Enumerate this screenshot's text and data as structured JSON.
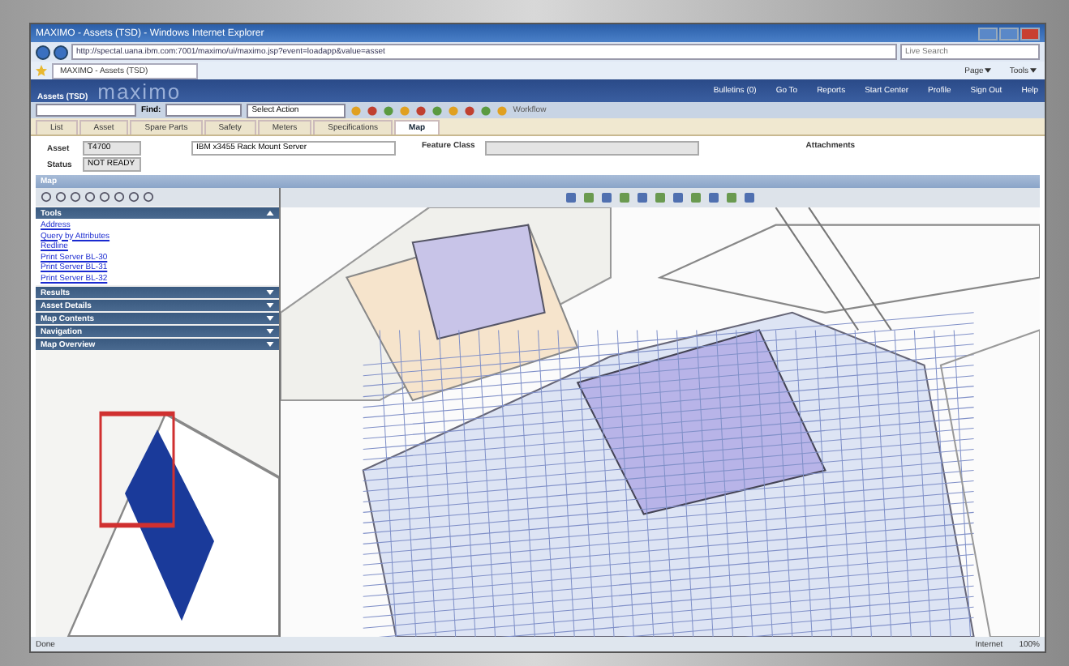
{
  "window": {
    "title": "MAXIMO - Assets (TSD) - Windows Internet Explorer"
  },
  "browser": {
    "address": "http://spectal.uana.ibm.com:7001/maximo/ui/maximo.jsp?event=loadapp&value=asset",
    "search_placeholder": "Live Search",
    "tab_title": "MAXIMO - Assets (TSD)",
    "commands": [
      {
        "label": "Page"
      },
      {
        "label": "Tools"
      }
    ]
  },
  "app": {
    "app_name": "Assets (TSD)",
    "logo": "maximo",
    "nav_links": [
      {
        "label": "Bulletins (0)"
      },
      {
        "label": "Go To"
      },
      {
        "label": "Reports"
      },
      {
        "label": "Start Center"
      },
      {
        "label": "Profile"
      },
      {
        "label": "Sign Out"
      },
      {
        "label": "Help"
      }
    ]
  },
  "toolbar": {
    "find_label": "Find:",
    "select_action": "Select Action",
    "filter_label": "Workflow"
  },
  "tabs": [
    {
      "label": "List",
      "selected": false
    },
    {
      "label": "Asset",
      "selected": false
    },
    {
      "label": "Spare Parts",
      "selected": false
    },
    {
      "label": "Safety",
      "selected": false
    },
    {
      "label": "Meters",
      "selected": false
    },
    {
      "label": "Specifications",
      "selected": false
    },
    {
      "label": "Map",
      "selected": true
    }
  ],
  "record": {
    "asset_label": "Asset",
    "asset_value": "T4700",
    "description": "IBM x3455 Rack Mount Server",
    "status_label": "Status",
    "status_value": "NOT READY",
    "feature_class_label": "Feature Class",
    "attachments_label": "Attachments"
  },
  "map_section": {
    "title": "Map"
  },
  "side_panel": {
    "sections": [
      {
        "title": "Tools",
        "expanded": true,
        "links": [
          "Address",
          "Query by Attributes",
          "Redline",
          "Print Server BL-30",
          "Print Server BL-31",
          "Print Server BL-32"
        ]
      },
      {
        "title": "Results",
        "expanded": false
      },
      {
        "title": "Asset Details",
        "expanded": false
      },
      {
        "title": "Map Contents",
        "expanded": false
      },
      {
        "title": "Navigation",
        "expanded": false
      },
      {
        "title": "Map Overview",
        "expanded": false
      }
    ]
  },
  "status_bar": {
    "text": "Done",
    "zone": "Internet",
    "zoom": "100%"
  }
}
